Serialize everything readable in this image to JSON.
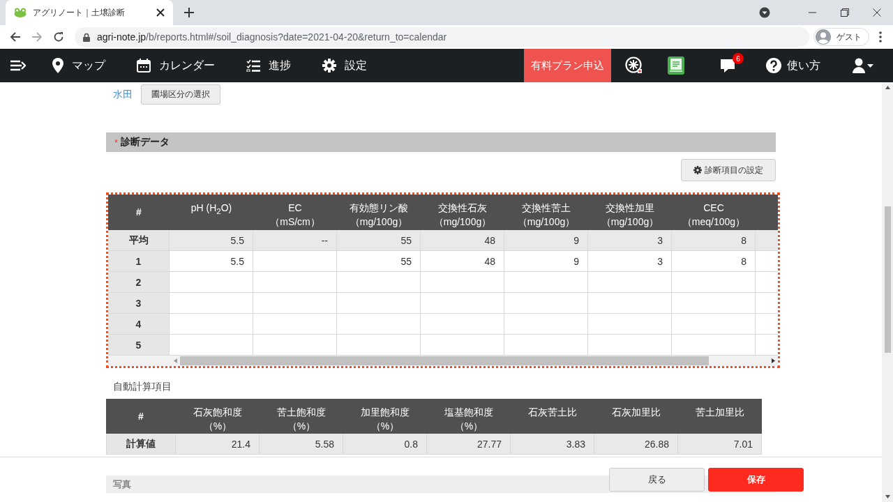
{
  "browser": {
    "tab_title": "アグリノート｜土壌診断",
    "url_domain": "agri-note.jp",
    "url_path": "/b/reports.html#/soil_diagnosis?date=2021-04-20&return_to=calendar",
    "profile": "ゲスト"
  },
  "navbar": {
    "items": [
      {
        "label": "マップ"
      },
      {
        "label": "カレンダー"
      },
      {
        "label": "進捗"
      },
      {
        "label": "設定"
      }
    ],
    "premium_button": "有料プラン申込",
    "notification_count": "6",
    "help": "使い方"
  },
  "field": {
    "name": "水田",
    "select_button": "圃場区分の選択"
  },
  "diagnosis": {
    "required_mark": "*",
    "title": "診断データ",
    "settings_button": "診断項目の設定",
    "columns": [
      {
        "label": "#"
      },
      {
        "label": "pH (H$_{2}$O)"
      },
      {
        "label": "EC",
        "unit": "（mS/cm）"
      },
      {
        "label": "有効態リン酸",
        "unit": "（mg/100g）"
      },
      {
        "label": "交換性石灰",
        "unit": "（mg/100g）"
      },
      {
        "label": "交換性苦土",
        "unit": "（mg/100g）"
      },
      {
        "label": "交換性加里",
        "unit": "（mg/100g）"
      },
      {
        "label": "CEC",
        "unit": "（meq/100g）"
      }
    ],
    "rows": [
      {
        "kind": "average",
        "cells": [
          "平均",
          "5.5",
          "--",
          "55",
          "48",
          "9",
          "3",
          "8"
        ]
      },
      {
        "kind": "sample",
        "cells": [
          "1",
          "5.5",
          "",
          "55",
          "48",
          "9",
          "3",
          "8"
        ]
      },
      {
        "kind": "sample",
        "cells": [
          "2",
          "",
          "",
          "",
          "",
          "",
          "",
          ""
        ]
      },
      {
        "kind": "sample",
        "cells": [
          "3",
          "",
          "",
          "",
          "",
          "",
          "",
          ""
        ]
      },
      {
        "kind": "sample",
        "cells": [
          "4",
          "",
          "",
          "",
          "",
          "",
          "",
          ""
        ]
      },
      {
        "kind": "sample",
        "cells": [
          "5",
          "",
          "",
          "",
          "",
          "",
          "",
          ""
        ]
      }
    ]
  },
  "calculated": {
    "title": "自動計算項目",
    "columns": [
      {
        "label": "#"
      },
      {
        "label": "石灰飽和度",
        "unit": "（%）"
      },
      {
        "label": "苦土飽和度",
        "unit": "（%）"
      },
      {
        "label": "加里飽和度",
        "unit": "（%）"
      },
      {
        "label": "塩基飽和度",
        "unit": "（%）"
      },
      {
        "label": "石灰苦土比"
      },
      {
        "label": "石灰加里比"
      },
      {
        "label": "苦土加里比"
      }
    ],
    "rows": [
      {
        "cells": [
          "計算値",
          "21.4",
          "5.58",
          "0.8",
          "27.77",
          "3.83",
          "26.88",
          "7.01"
        ]
      }
    ]
  },
  "photo_section": {
    "title": "写真"
  },
  "footer": {
    "back_button": "戻る",
    "save_button": "保存"
  }
}
